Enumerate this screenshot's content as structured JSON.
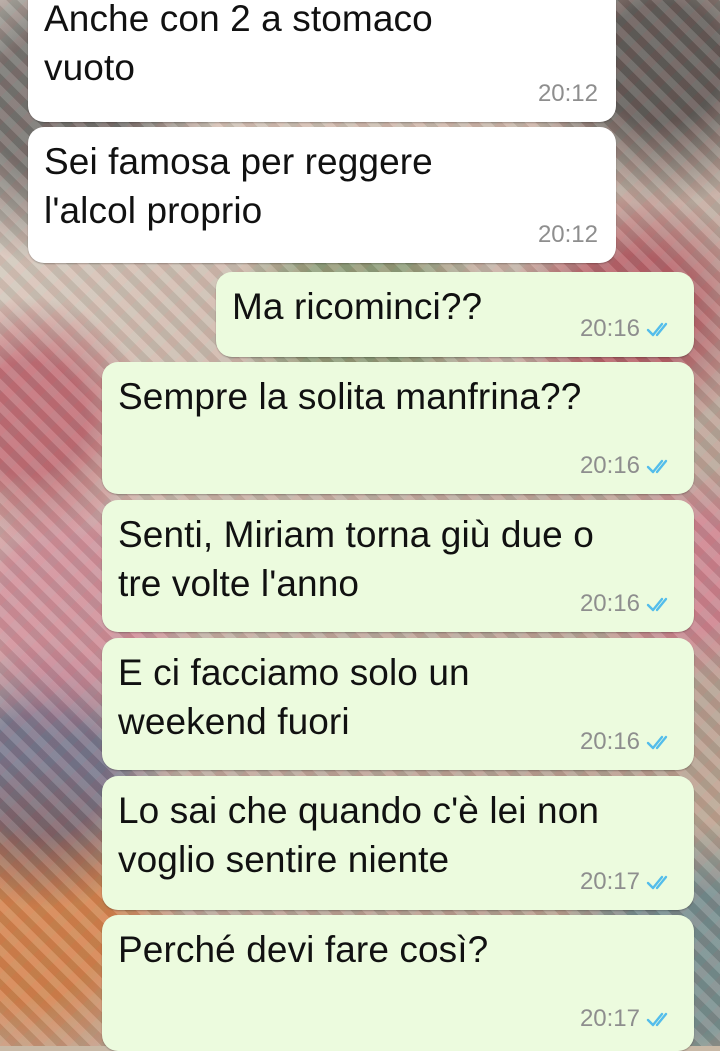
{
  "messages": [
    {
      "id": "m1",
      "direction": "in",
      "text": "Anche con 2 a stomaco\nvuoto",
      "time": "20:12"
    },
    {
      "id": "m2",
      "direction": "in",
      "text": "Sei famosa per reggere\nl'alcol proprio",
      "time": "20:12"
    },
    {
      "id": "m3",
      "direction": "out",
      "text": "Ma ricominci??",
      "time": "20:16",
      "status": "read"
    },
    {
      "id": "m4",
      "direction": "out",
      "text": "Sempre la solita manfrina??",
      "time": "20:16",
      "status": "read"
    },
    {
      "id": "m5",
      "direction": "out",
      "text": "Senti, Miriam torna giù due o\ntre volte l'anno",
      "time": "20:16",
      "status": "read"
    },
    {
      "id": "m6",
      "direction": "out",
      "text": "E ci facciamo solo un\nweekend fuori",
      "time": "20:16",
      "status": "read"
    },
    {
      "id": "m7",
      "direction": "out",
      "text": "Lo sai che quando c'è lei non\nvoglio sentire niente",
      "time": "20:17",
      "status": "read"
    },
    {
      "id": "m8",
      "direction": "out",
      "text": "Perché devi fare così?",
      "time": "20:17",
      "status": "read"
    }
  ],
  "colors": {
    "incoming_bubble": "#ffffff",
    "outgoing_bubble": "#ecfbde",
    "read_ticks": "#53bdeb",
    "timestamp": "#8e8e8e"
  },
  "icons": {
    "read_receipt": "double-check-icon"
  }
}
